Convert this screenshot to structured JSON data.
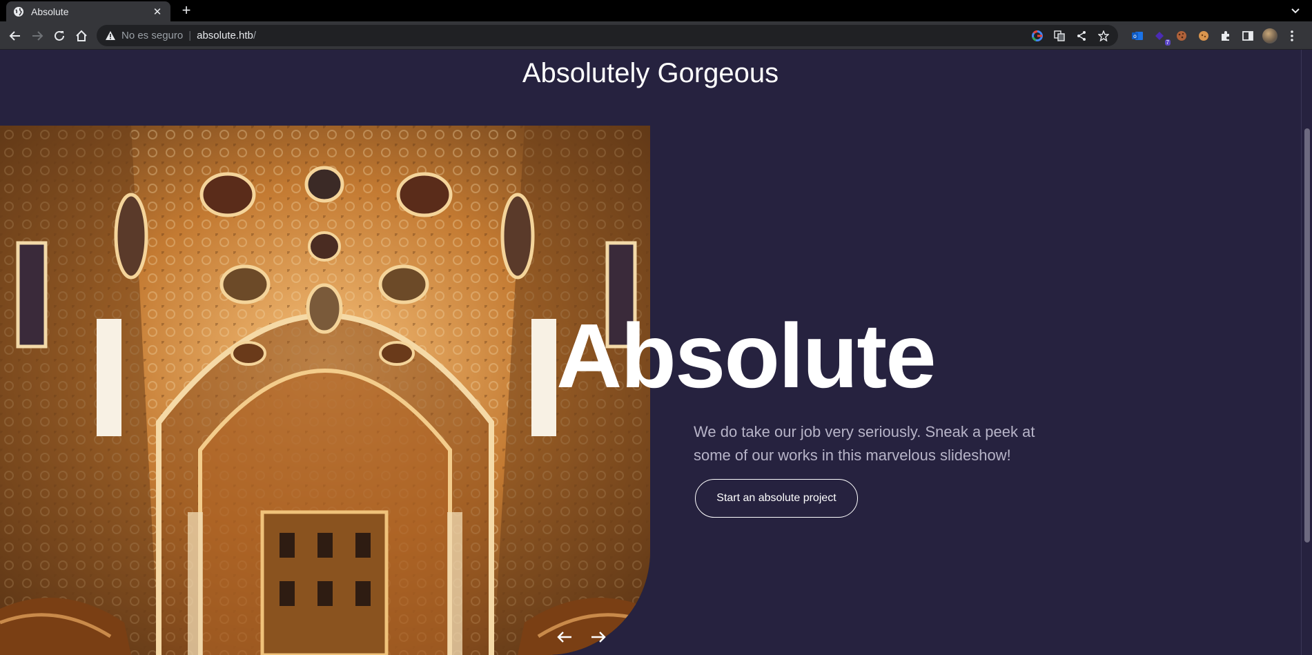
{
  "browser": {
    "tab": {
      "title": "Absolute",
      "favicon": "globe-icon"
    },
    "omnibox": {
      "security_label": "No es seguro",
      "url_host": "absolute.htb",
      "url_path": "/"
    },
    "extensions": [
      "google-lens-icon",
      "translate-icon",
      "share-icon",
      "bookmark-star-icon",
      "outlook-icon",
      "purple-extension-icon",
      "cookie-icon",
      "cookie-editor-icon",
      "puzzle-icon",
      "side-panel-icon",
      "profile-avatar",
      "more-menu-icon"
    ],
    "extension_badge": "7"
  },
  "page": {
    "site_title": "Absolutely Gorgeous",
    "hero": {
      "heading": "Absolute",
      "description": "We do take our job very seriously. Sneak a peek at some of our works in this marvelous slideshow!",
      "cta_label": "Start an absolute project"
    },
    "slider": {
      "prev_icon": "arrow-left-icon",
      "next_icon": "arrow-right-icon"
    }
  },
  "colors": {
    "page_background": "#26223f",
    "heading": "#ffffff",
    "body_text": "#b7b4c8",
    "browser_toolbar": "#35363a",
    "omnibox": "#202124"
  }
}
